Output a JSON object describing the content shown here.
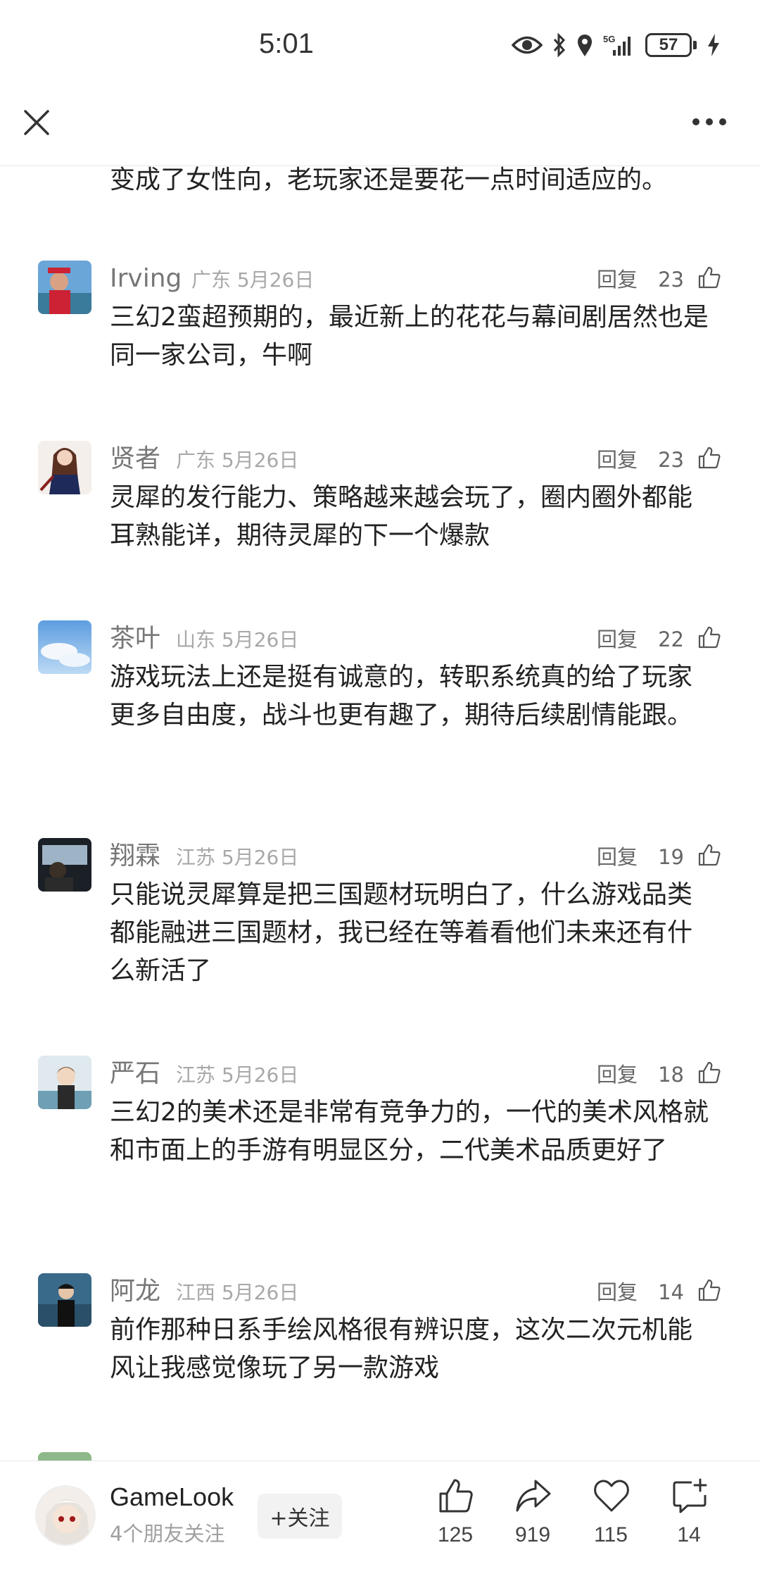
{
  "status": {
    "time": "5:01",
    "battery": "57",
    "network": "5G"
  },
  "header": {
    "close_icon": "close-icon",
    "more_icon": "more-icon"
  },
  "previous_comment_tail": "变成了女性向，老玩家还是要花一点时间适应的。",
  "comments": [
    {
      "name": "Irving",
      "location": "广东",
      "date": "5月26日",
      "reply": "回复",
      "likes": "23",
      "text": "三幻2蛮超预期的，最近新上的花花与幕间剧居然也是同一家公司，牛啊"
    },
    {
      "name": "贤者",
      "location": "广东",
      "date": "5月26日",
      "reply": "回复",
      "likes": "23",
      "text": "灵犀的发行能力、策略越来越会玩了，圈内圈外都能耳熟能详，期待灵犀的下一个爆款"
    },
    {
      "name": "茶叶",
      "location": "山东",
      "date": "5月26日",
      "reply": "回复",
      "likes": "22",
      "text": "游戏玩法上还是挺有诚意的，转职系统真的给了玩家更多自由度，战斗也更有趣了，期待后续剧情能跟。"
    },
    {
      "name": "翔霖",
      "location": "江苏",
      "date": "5月26日",
      "reply": "回复",
      "likes": "19",
      "text": "只能说灵犀算是把三国题材玩明白了，什么游戏品类都能融进三国题材，我已经在等着看他们未来还有什么新活了"
    },
    {
      "name": "严石",
      "location": "江苏",
      "date": "5月26日",
      "reply": "回复",
      "likes": "18",
      "text": "三幻2的美术还是非常有竞争力的，一代的美术风格就和市面上的手游有明显区分，二代美术品质更好了"
    },
    {
      "name": "阿龙",
      "location": "江西",
      "date": "5月26日",
      "reply": "回复",
      "likes": "14",
      "text": "前作那种日系手绘风格很有辨识度，这次二次元机能风让我感觉像玩了另一款游戏"
    }
  ],
  "bottom_bar": {
    "author_name": "GameLook",
    "author_sub": "4个朋友关注",
    "follow_label": "+关注",
    "like_count": "125",
    "share_count": "919",
    "favorite_count": "115",
    "comment_count": "14"
  }
}
